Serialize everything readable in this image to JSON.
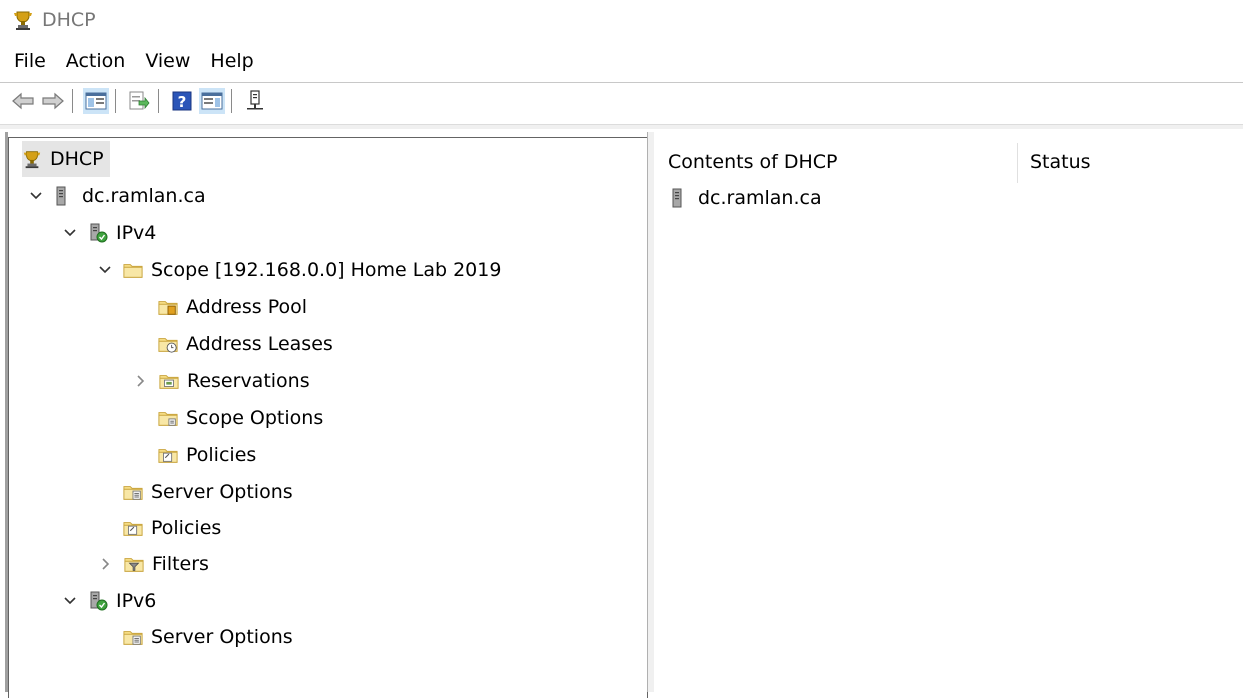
{
  "window": {
    "title": "DHCP",
    "icon": "dhcp-trophy-icon"
  },
  "menu": {
    "items": [
      "File",
      "Action",
      "View",
      "Help"
    ]
  },
  "toolbar": {
    "buttons": [
      "back-arrow-icon",
      "forward-arrow-icon",
      "show-hide-console-tree-icon",
      "export-list-icon",
      "help-icon",
      "show-action-pane-icon",
      "server-plug-icon"
    ]
  },
  "tree": {
    "root": "DHCP",
    "server": "dc.ramlan.ca",
    "ipv4": "IPv4",
    "scope": "Scope [192.168.0.0] Home Lab 2019",
    "scope_children": [
      "Address Pool",
      "Address Leases",
      "Reservations",
      "Scope Options",
      "Policies"
    ],
    "ipv4_children": [
      "Server Options",
      "Policies",
      "Filters"
    ],
    "ipv6": "IPv6",
    "ipv6_children": [
      "Server Options"
    ]
  },
  "details": {
    "columns": [
      "Contents of DHCP",
      "Status"
    ],
    "rows": [
      {
        "name": "dc.ramlan.ca",
        "status": ""
      }
    ]
  },
  "colors": {
    "folder": "#f0d77a",
    "selection": "#e5e5e5",
    "server": "#9a9a9a"
  }
}
